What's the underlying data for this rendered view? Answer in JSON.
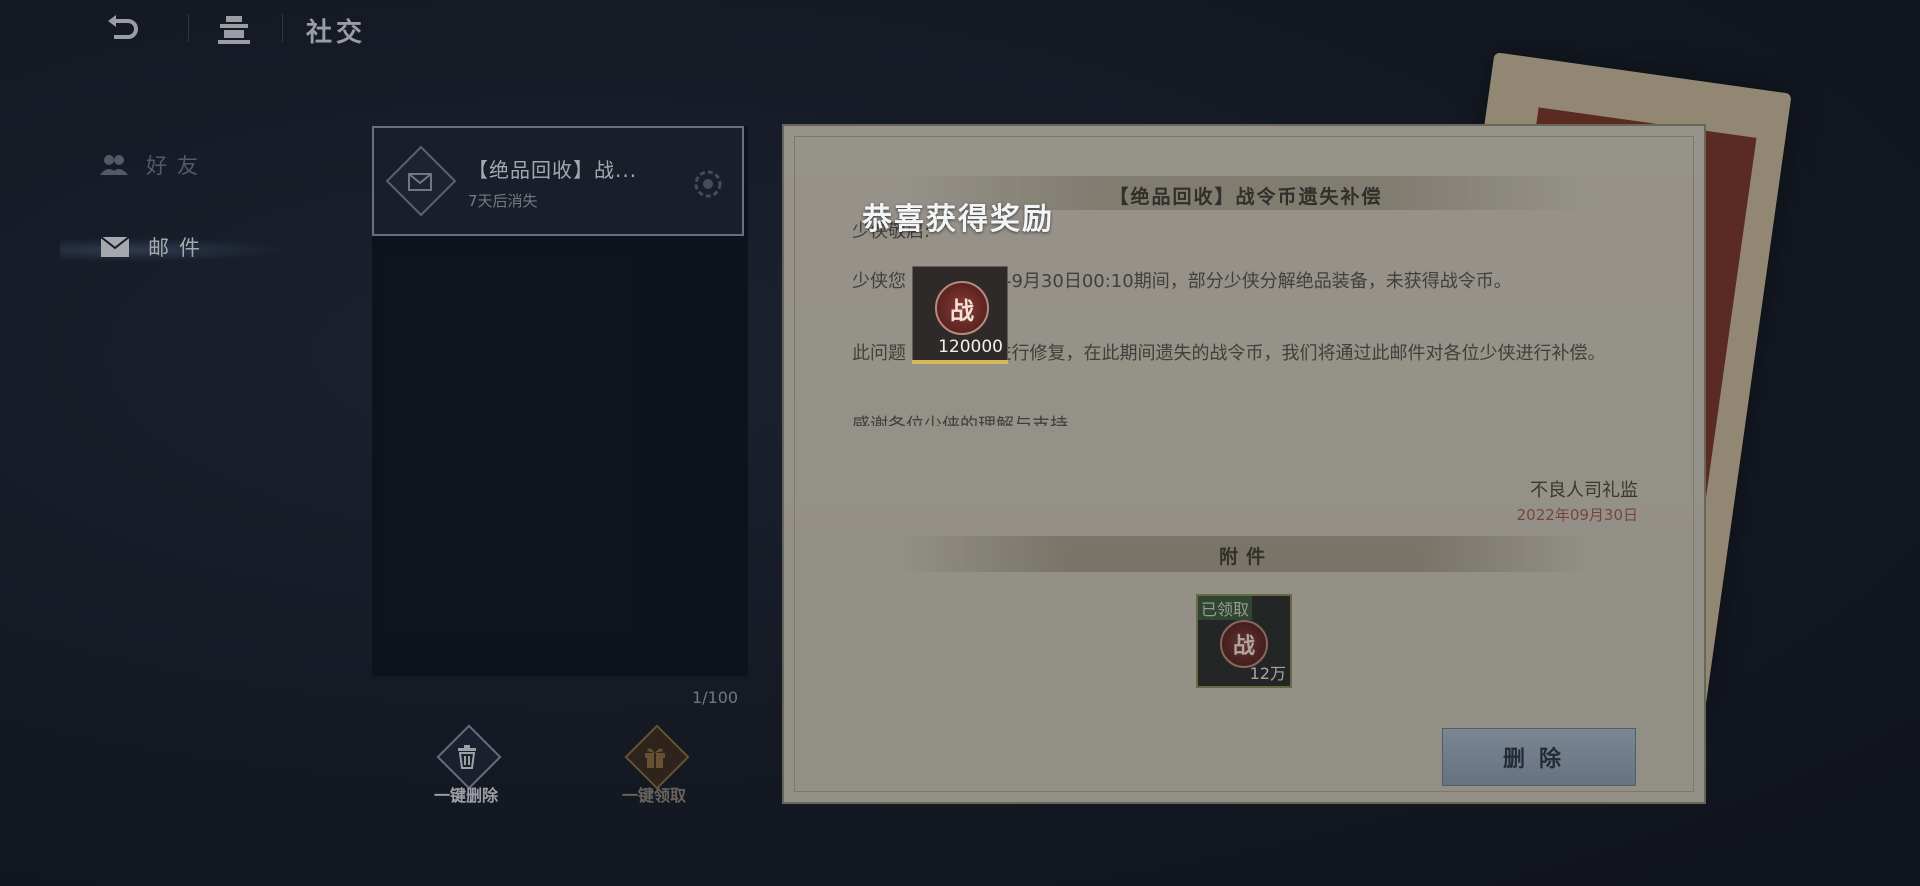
{
  "header": {
    "back_icon": "back-arrow-icon",
    "home_icon": "pavilion-icon",
    "title": "社交"
  },
  "sidebar": {
    "items": [
      {
        "label": "好友",
        "icon": "friends-icon",
        "active": false
      },
      {
        "label": "邮件",
        "icon": "envelope-icon",
        "active": true
      }
    ]
  },
  "mail_list": {
    "items": [
      {
        "subject": "【绝品回收】战...",
        "expire": "7天后消失",
        "icon": "envelope-icon"
      }
    ],
    "count": "1/100",
    "delete_all_label": "一键删除",
    "claim_all_label": "一键领取"
  },
  "mail_detail": {
    "title": "【绝品回收】战令币遗失补偿",
    "greeting": "少侠敬启:",
    "paragraph1": "少侠您 9日12：00-9月30日00:10期间，部分少侠分解绝品装备，未获得战令币。",
    "paragraph2": "此问题 日00：10进行修复，在此期间遗失的战令币，我们将通过此邮件对各位少侠进行补偿。",
    "paragraph3": "感谢各位少侠的理解与支持",
    "signer": "不良人司礼监",
    "date": "2022年09月30日",
    "attachment_label": "附件",
    "attachment": {
      "claimed_label": "已领取",
      "emblem": "战",
      "quantity": "12万"
    },
    "delete_label": "删除"
  },
  "reward_popup": {
    "title": "恭喜获得奖励",
    "item": {
      "emblem": "战",
      "quantity": "120000"
    }
  },
  "colors": {
    "background": "#161c2a",
    "paper": "#cfc9bb",
    "accent_gold": "#d9b85a",
    "date_red": "#a35a4c",
    "button_blue": "#a8b6c7"
  }
}
